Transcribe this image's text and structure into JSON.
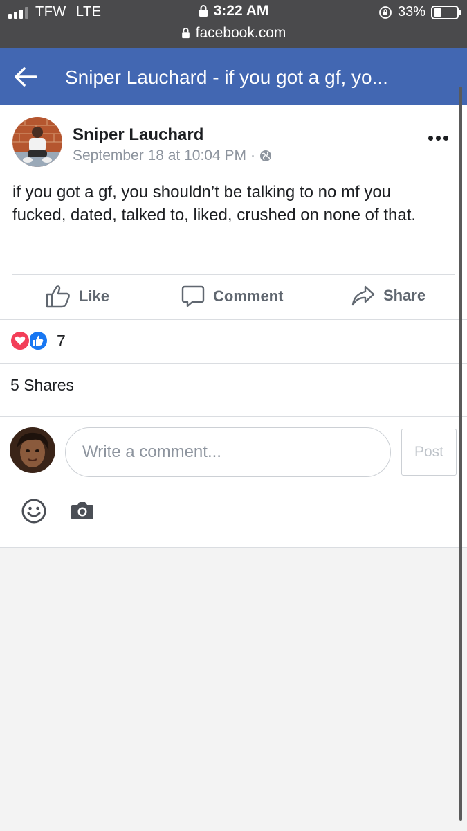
{
  "status_bar": {
    "carrier": "TFW",
    "network": "LTE",
    "time": "3:22 AM",
    "battery": "33%",
    "battery_level": 0.33,
    "url": "facebook.com"
  },
  "header": {
    "title": "Sniper Lauchard - if you got a gf, yo..."
  },
  "post": {
    "author": "Sniper Lauchard",
    "timestamp": "September 18 at 10:04 PM",
    "separator": "·",
    "text": "if you got a gf, you shouldn’t be talking to no mf you fucked, dated, talked to, liked, crushed on none of that."
  },
  "actions": {
    "like": "Like",
    "comment": "Comment",
    "share": "Share"
  },
  "reactions": {
    "count": "7"
  },
  "shares": {
    "label": "5 Shares"
  },
  "composer": {
    "placeholder": "Write a comment...",
    "post_label": "Post"
  },
  "colors": {
    "brand": "#4267b2",
    "status_bar": "#4a4a4c",
    "love": "#f33e58",
    "like": "#1877f2",
    "muted_text": "#606770"
  }
}
